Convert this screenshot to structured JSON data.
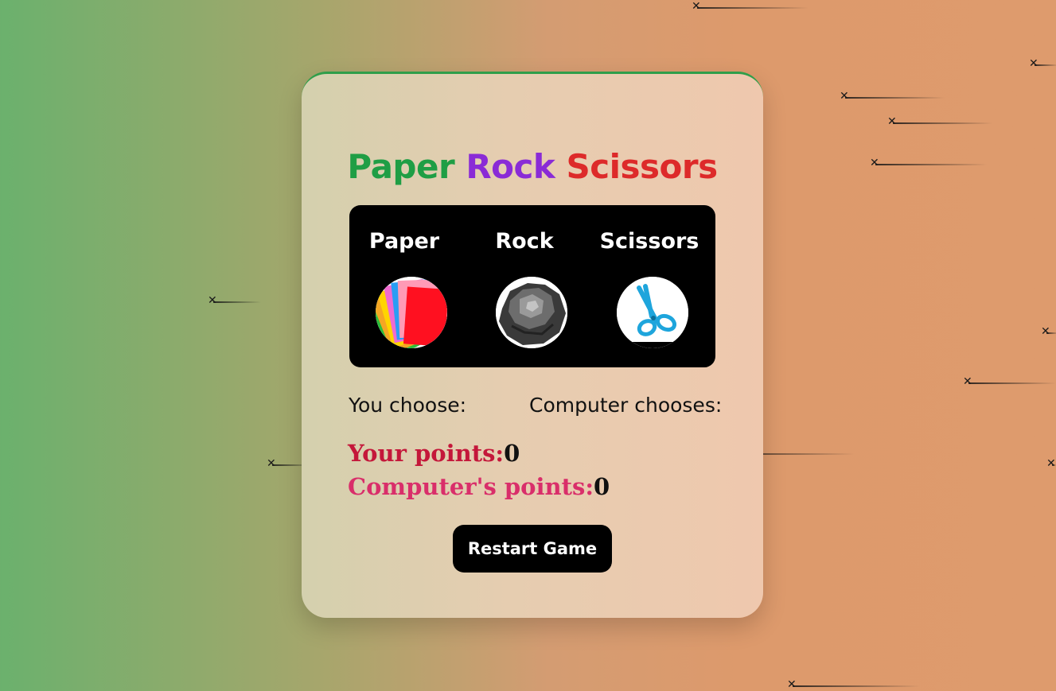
{
  "title": {
    "word1": "Paper",
    "word2": "Rock",
    "word3": "Scissors"
  },
  "choices": [
    {
      "label": "Paper",
      "icon": "paper-stack-icon"
    },
    {
      "label": "Rock",
      "icon": "rock-icon"
    },
    {
      "label": "Scissors",
      "icon": "scissors-icon"
    }
  ],
  "status": {
    "you_label": "You choose:",
    "computer_label": "Computer chooses:"
  },
  "scores": {
    "player_label": "Your points:",
    "player_value": "0",
    "computer_label": "Computer's points:",
    "computer_value": "0"
  },
  "restart_label": "Restart Game",
  "colors": {
    "paper": "#1f9e45",
    "rock": "#8a2bd6",
    "scissors": "#dd2a2a",
    "player_points": "#c4173a",
    "computer_points": "#d92e6a"
  }
}
